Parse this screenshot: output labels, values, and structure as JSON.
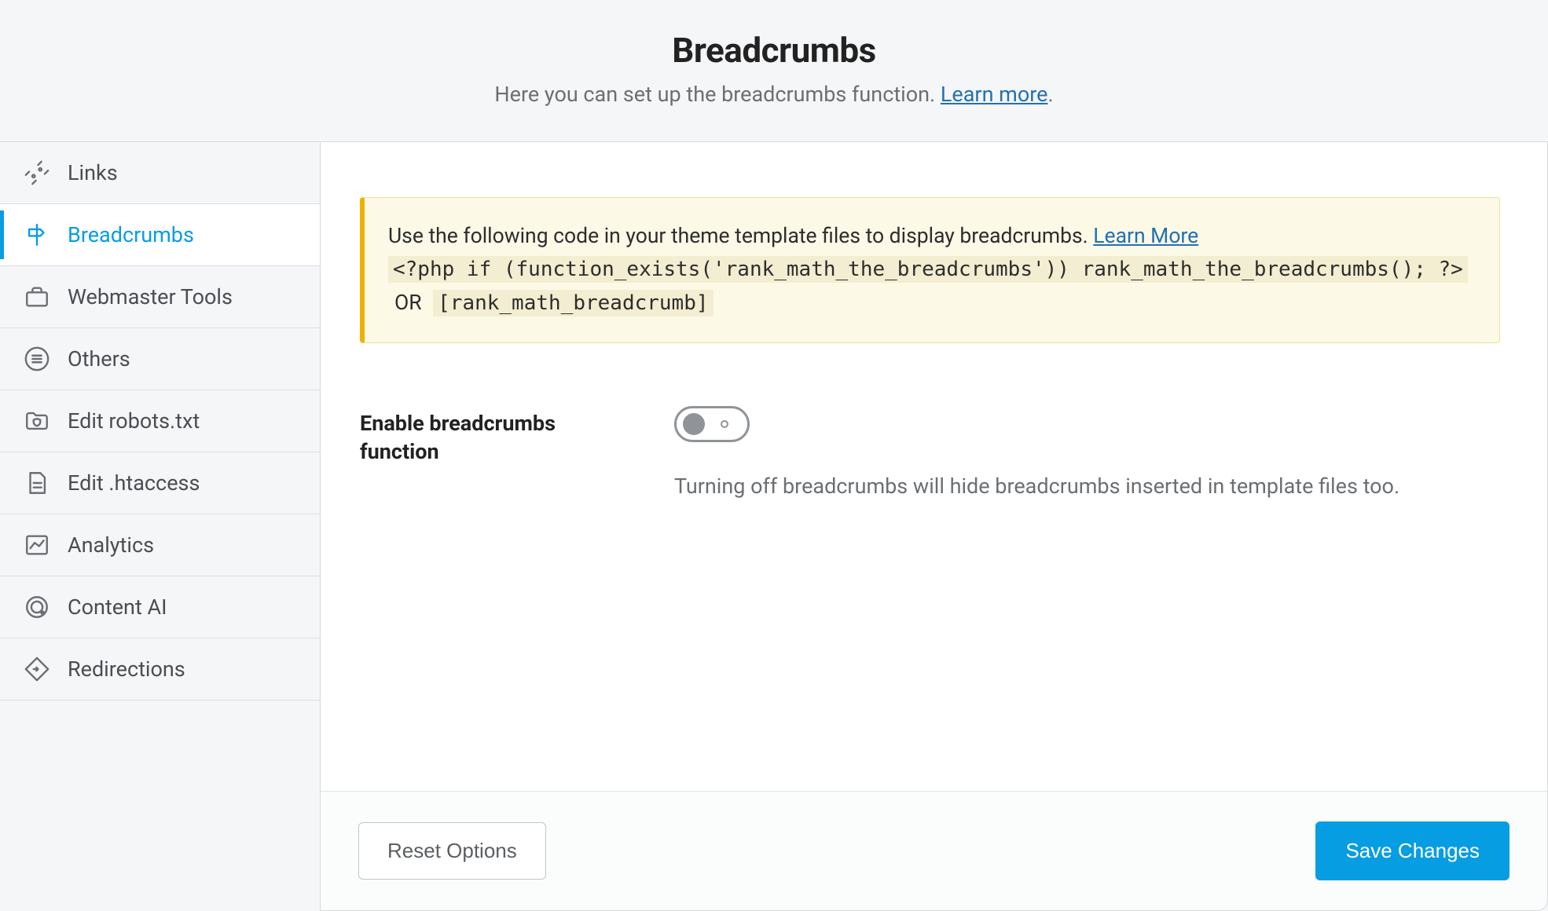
{
  "header": {
    "title": "Breadcrumbs",
    "subtitle_prefix": "Here you can set up the breadcrumbs function. ",
    "subtitle_link": "Learn more",
    "subtitle_suffix": "."
  },
  "sidebar": {
    "items": [
      {
        "label": "Links",
        "icon": "links-icon",
        "active": false
      },
      {
        "label": "Breadcrumbs",
        "icon": "signpost-icon",
        "active": true
      },
      {
        "label": "Webmaster Tools",
        "icon": "briefcase-icon",
        "active": false
      },
      {
        "label": "Others",
        "icon": "list-circle-icon",
        "active": false
      },
      {
        "label": "Edit robots.txt",
        "icon": "folder-shield-icon",
        "active": false
      },
      {
        "label": "Edit .htaccess",
        "icon": "file-lines-icon",
        "active": false
      },
      {
        "label": "Analytics",
        "icon": "chart-icon",
        "active": false
      },
      {
        "label": "Content AI",
        "icon": "target-icon",
        "active": false
      },
      {
        "label": "Redirections",
        "icon": "diamond-arrow-icon",
        "active": false
      }
    ]
  },
  "notice": {
    "text": "Use the following code in your theme template files to display breadcrumbs. ",
    "learn_more": "Learn More",
    "code_php": "<?php if (function_exists('rank_math_the_breadcrumbs')) rank_math_the_breadcrumbs(); ?>",
    "or": "OR",
    "code_short": "[rank_math_breadcrumb]"
  },
  "fields": {
    "enable": {
      "label": "Enable breadcrumbs function",
      "value": false,
      "help": "Turning off breadcrumbs will hide breadcrumbs inserted in template files too."
    }
  },
  "footer": {
    "reset": "Reset Options",
    "save": "Save Changes"
  }
}
